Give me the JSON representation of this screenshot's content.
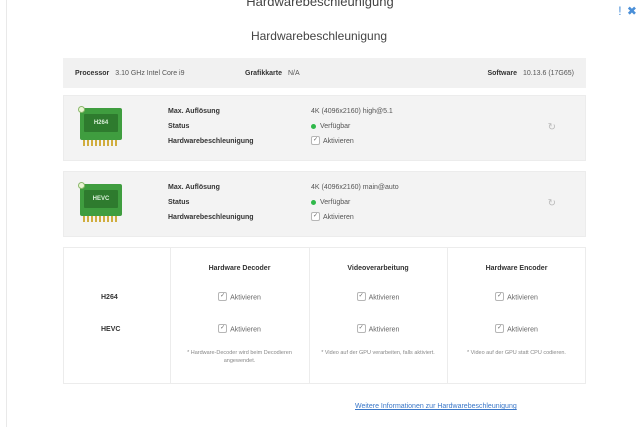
{
  "top_partial_text": "Hardwarebeschleunigung",
  "corner_glyphs": "! ✖",
  "title": "Hardwarebeschleunigung",
  "info": {
    "processor_label": "Processor",
    "processor_value": "3.10 GHz Intel Core i9",
    "graphics_label": "Grafikkarte",
    "graphics_value": "N/A",
    "software_label": "Software",
    "software_value": "10.13.6 (17G65)"
  },
  "codecs": [
    {
      "chip_label": "H264",
      "labels": [
        "Max. Auflösung",
        "Status",
        "Hardwarebeschleunigung"
      ],
      "resolution": "4K (4096x2160) high@5.1",
      "status": "Verfügbar",
      "status_color": "#2fb84a",
      "enable_label": "Aktivieren",
      "icon": "refresh-icon"
    },
    {
      "chip_label": "HEVC",
      "labels": [
        "Max. Auflösung",
        "Status",
        "Hardwarebeschleunigung"
      ],
      "resolution": "4K (4096x2160) main@auto",
      "status": "Verfügbar",
      "status_color": "#2fb84a",
      "enable_label": "Aktivieren",
      "icon": "refresh-icon"
    }
  ],
  "matrix": {
    "columns": [
      "Hardware Decoder",
      "Videoverarbeitung",
      "Hardware Encoder"
    ],
    "rows": [
      "H264",
      "HEVC"
    ],
    "cell_label": "Aktivieren",
    "notes": [
      "* Hardware-Decoder wird beim Decodieren angewendet.",
      "* Video auf der GPU verarbeiten, falls aktiviert.",
      "* Video auf der GPU statt CPU codieren."
    ]
  },
  "more_info_link": "Weitere Informationen zur Hardwarebeschleunigung",
  "accent_color": "#3a77c8"
}
